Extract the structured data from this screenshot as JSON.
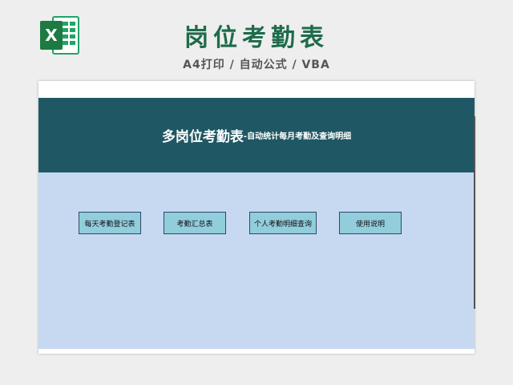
{
  "header": {
    "title": "岗位考勤表",
    "subtitle": "A4打印 / 自动公式 / VBA",
    "logo_letter": "X"
  },
  "sheet": {
    "banner_title": "多岗位考勤表",
    "banner_sub": "-自动统计每月考勤及查询明细",
    "buttons": [
      {
        "label": "每天考勤登记表"
      },
      {
        "label": "考勤汇总表"
      },
      {
        "label": "个人考勤明细查询"
      },
      {
        "label": "使用说明"
      }
    ]
  },
  "colors": {
    "brand_green": "#1e6b4a",
    "banner": "#1f5864",
    "panel": "#c6d9f1",
    "button": "#92cddc"
  }
}
